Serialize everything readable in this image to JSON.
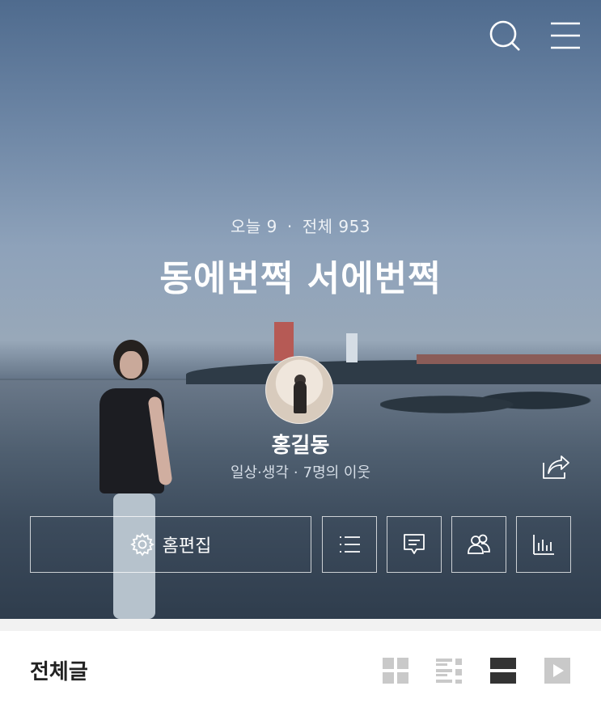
{
  "header": {
    "search_icon": "search-icon",
    "menu_icon": "hamburger-menu-icon"
  },
  "blog": {
    "visits_today_label": "오늘 9",
    "visits_total_label": "전체 953",
    "dot": "·",
    "title": "동에번쩍 서에번쩍"
  },
  "owner": {
    "name": "홍길동",
    "category": "일상·생각",
    "sep": "·",
    "neighbors": "7명의 이웃"
  },
  "actions": {
    "edit_label": "홈편집",
    "buttons": [
      "list-icon",
      "comment-icon",
      "neighbors-icon",
      "stats-icon"
    ]
  },
  "posts": {
    "section_title": "전체글",
    "view_modes": [
      "grid-view-icon",
      "list-view-icon",
      "card-view-icon",
      "video-view-icon"
    ],
    "active_view": "card-view-icon"
  },
  "colors": {
    "white": "#ffffff",
    "inactive_view": "#c9c9c9",
    "active_view": "#333333"
  }
}
